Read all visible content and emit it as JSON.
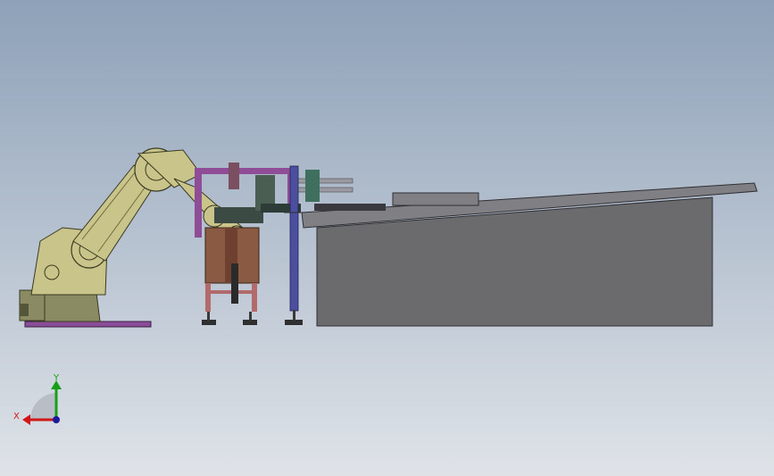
{
  "viewport": {
    "background_top": "#8ea1b8",
    "background_bottom": "#dfe3e8"
  },
  "triad": {
    "x_label": "X",
    "y_label": "Y",
    "x_color": "#d01818",
    "y_color": "#17a017",
    "z_color": "#1a1a9a"
  },
  "colors": {
    "robot": "#c9c48a",
    "robot_dark": "#6f6d3e",
    "robot_base": "#8b8b63",
    "base_plate": "#8a4d98",
    "frame_purple": "#8f4d98",
    "cabinet": "#8a5a42",
    "cabinet_legs": "#b36a6a",
    "column": "#4b4f9e",
    "conveyor": "#6b6b6e",
    "conveyor_edge": "#2f2f33",
    "conveyor_top": "#808084",
    "rail": "#9a9aa2"
  }
}
